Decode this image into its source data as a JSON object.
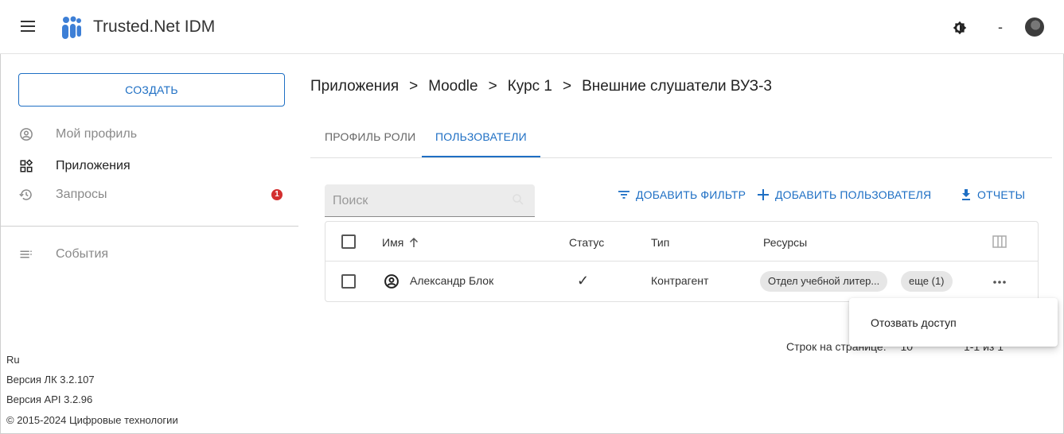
{
  "app": {
    "title": "Trusted.Net IDM",
    "user_initial": "-"
  },
  "sidebar": {
    "create_label": "СОЗДАТЬ",
    "items": [
      {
        "label": "Мой профиль",
        "icon": "account-circle-icon"
      },
      {
        "label": "Приложения",
        "icon": "apps-grid-icon"
      },
      {
        "label": "Запросы",
        "icon": "history-icon",
        "badge": "1"
      },
      {
        "label": "События",
        "icon": "events-list-icon"
      }
    ],
    "footer": {
      "language": "Ru",
      "version_lk": "Версия ЛК 3.2.107",
      "version_api": "Версия API 3.2.96",
      "copyright": "© 2015-2024 Цифровые технологии"
    }
  },
  "breadcrumb": [
    "Приложения",
    "Moodle",
    "Курс 1",
    "Внешние слушатели ВУЗ-3"
  ],
  "breadcrumb_separator": ">",
  "tabs": [
    {
      "label": "ПРОФИЛЬ РОЛИ",
      "active": false
    },
    {
      "label": "ПОЛЬЗОВАТЕЛИ",
      "active": true
    }
  ],
  "search": {
    "placeholder": "Поиск"
  },
  "actions": {
    "add_filter": "ДОБАВИТЬ ФИЛЬТР",
    "add_user": "ДОБАВИТЬ ПОЛЬЗОВАТЕЛЯ",
    "reports": "ОТЧЕТЫ"
  },
  "table": {
    "columns": {
      "name": "Имя",
      "status": "Статус",
      "type": "Тип",
      "resources": "Ресурсы"
    },
    "sort": {
      "column": "name",
      "direction": "ascending"
    },
    "rows": [
      {
        "name": "Александр Блок",
        "status": "✓",
        "type": "Контрагент",
        "resource_chip": "Отдел учебной литер...",
        "more_chip": "еще (1)"
      }
    ]
  },
  "context_menu": {
    "item": "Отозвать доступ"
  },
  "pagination": {
    "rows_per_page": "Строк на странице:",
    "per_page_value": "10",
    "range": "1-1 из 1"
  },
  "colors": {
    "accent": "#1e6fc4",
    "badge": "#d32f2f",
    "logo": "#3d7fd6"
  }
}
